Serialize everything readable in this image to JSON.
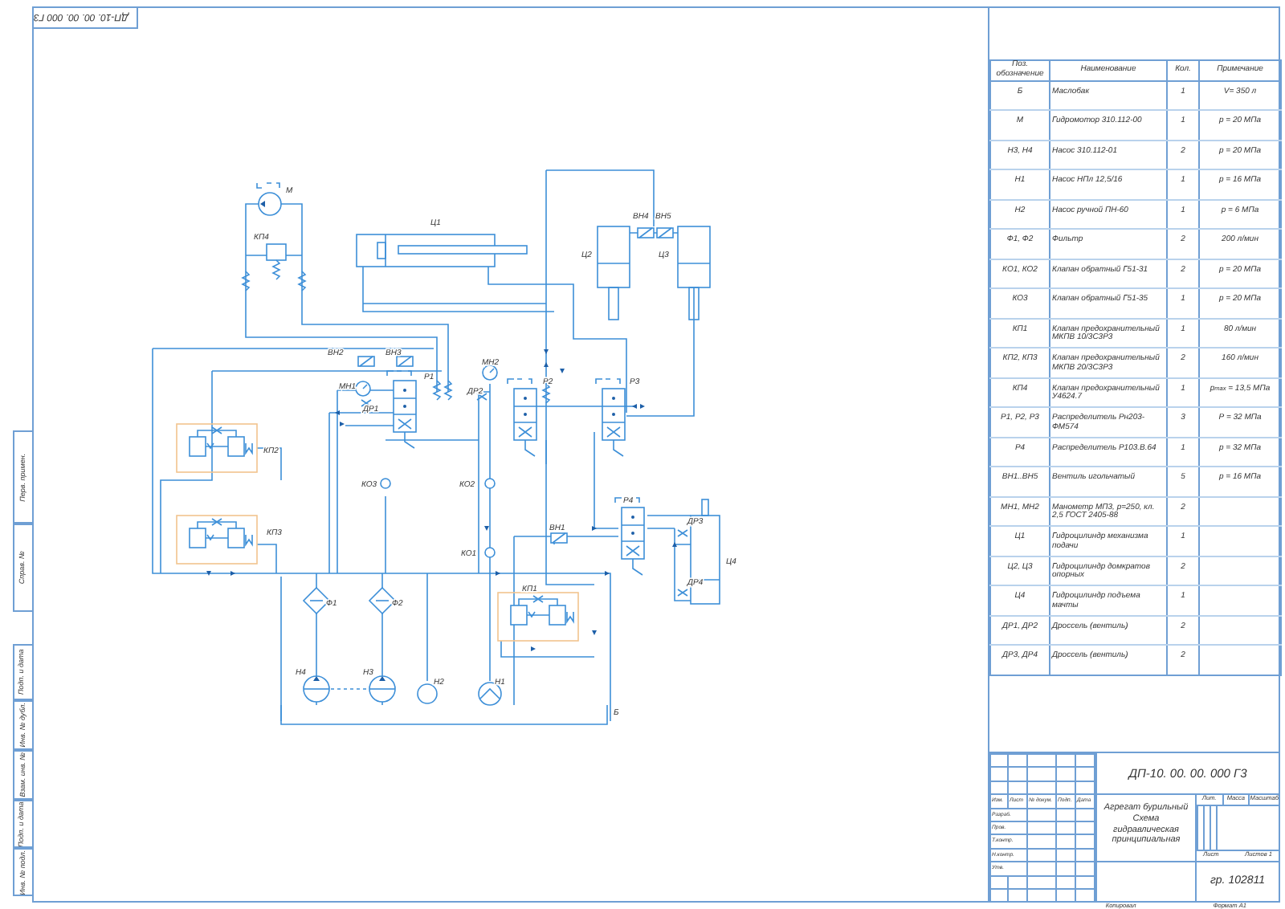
{
  "sheet": {
    "stamp": "ДП-10. 00. 00. 000 Г3",
    "margin_fields": [
      "Перв. примен.",
      "Справ. №",
      "Подп. и дата",
      "Инв. № дубл.",
      "Взам. инв. №",
      "Подп. и дата",
      "Инв. № подл."
    ]
  },
  "schematic": {
    "labels": [
      "М",
      "КП4",
      "Ц1",
      "Ц2",
      "Ц3",
      "ВН4",
      "ВН5",
      "ВН2",
      "ВН3",
      "МН1",
      "ДР1",
      "Р1",
      "МН2",
      "ДР2",
      "Р2",
      "Р3",
      "КП2",
      "КО3",
      "КО2",
      "КО1",
      "КП3",
      "ВН1",
      "Р4",
      "ДР3",
      "ДР4",
      "Ц4",
      "КП1",
      "Ф1",
      "Ф2",
      "Н4",
      "Н3",
      "Н2",
      "Н1",
      "Б"
    ]
  },
  "parts_list": {
    "columns": [
      "Поз. обозначение",
      "Наименование",
      "Кол.",
      "Примечание"
    ],
    "rows": [
      {
        "designation": "Б",
        "name": "Маслобак",
        "quantity": "1",
        "note": "V= 350 л"
      },
      {
        "designation": "М",
        "name": "Гидромотор 310.112-00",
        "quantity": "1",
        "note": "р = 20 МПа"
      },
      {
        "designation": "Н3, Н4",
        "name": "Насос 310.112-01",
        "quantity": "2",
        "note": "р = 20 МПа"
      },
      {
        "designation": "Н1",
        "name": "Насос НПл 12,5/16",
        "quantity": "1",
        "note": "р = 16 МПа"
      },
      {
        "designation": "Н2",
        "name": "Насос ручной ПН-60",
        "quantity": "1",
        "note": "р = 6 МПа"
      },
      {
        "designation": "Ф1, Ф2",
        "name": "Фильтр",
        "quantity": "2",
        "note": "200 л/мин"
      },
      {
        "designation": "КО1, КО2",
        "name": "Клапан обратный Г51-31",
        "quantity": "2",
        "note": "р = 20 МПа"
      },
      {
        "designation": "КО3",
        "name": "Клапан обратный Г51-35",
        "quantity": "1",
        "note": "р = 20 МПа"
      },
      {
        "designation": "КП1",
        "name": "Клапан предохранительный МКПВ 10/3С3Р3",
        "quantity": "1",
        "note": "80 л/мин"
      },
      {
        "designation": "КП2, КП3",
        "name": "Клапан предохранительный МКПВ 20/3С3Р3",
        "quantity": "2",
        "note": "160 л/мин"
      },
      {
        "designation": "КП4",
        "name": "Клапан предохранительный У4624.7",
        "quantity": "1",
        "note": "р$_{max}$ = 13,5 МПа"
      },
      {
        "designation": "Р1, Р2, Р3",
        "name": "Распределитель Рн203-ФМ574",
        "quantity": "3",
        "note": "Р = 32 МПа"
      },
      {
        "designation": "Р4",
        "name": "Распределитель Р103.В.64",
        "quantity": "1",
        "note": "р = 32 МПа"
      },
      {
        "designation": "ВН1..ВН5",
        "name": "Вентиль игольчатый",
        "quantity": "5",
        "note": "р = 16 МПа"
      },
      {
        "designation": "МН1, МН2",
        "name": "Манометр МП3, р=250, кл. 2,5 ГОСТ 2405-88",
        "quantity": "2",
        "note": ""
      },
      {
        "designation": "Ц1",
        "name": "Гидроцилиндр механизма подачи",
        "quantity": "1",
        "note": ""
      },
      {
        "designation": "Ц2, Ц3",
        "name": "Гидроцилиндр домкратов опорных",
        "quantity": "2",
        "note": ""
      },
      {
        "designation": "Ц4",
        "name": "Гидроцилиндр подъема мачты",
        "quantity": "1",
        "note": ""
      },
      {
        "designation": "ДР1, ДР2",
        "name": "Дроссель (вентиль)",
        "quantity": "2",
        "note": ""
      },
      {
        "designation": "ДР3, ДР4",
        "name": "Дроссель (вентиль)",
        "quantity": "2",
        "note": ""
      }
    ]
  },
  "title_block": {
    "designation": "ДП-10. 00. 00. 000 Г3",
    "title": "Агрегат бурильный",
    "subtitle": "Схема гидравлическая принципиальная",
    "revision_headers": [
      "Изм.",
      "Лист",
      "№ докум.",
      "Подп.",
      "Дата"
    ],
    "roles": [
      "Разраб.",
      "Пров.",
      "Т.контр.",
      "Н.контр.",
      "Утв."
    ],
    "letter_headers": [
      "Лит.",
      "Масса",
      "Масштаб"
    ],
    "sheet": "Лист",
    "sheets": "Листов 1",
    "group": "гр. 102811",
    "copied": "Копировал",
    "format": "Формат А1"
  }
}
